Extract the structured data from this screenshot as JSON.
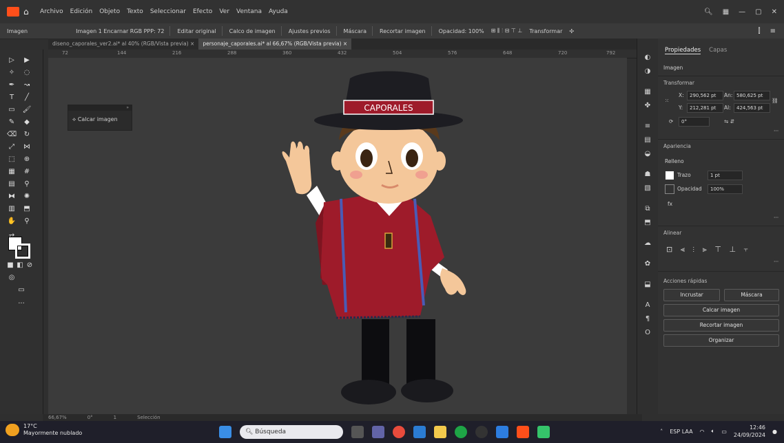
{
  "menubar": {
    "items": [
      "Archivo",
      "Edición",
      "Objeto",
      "Texto",
      "Seleccionar",
      "Efecto",
      "Ver",
      "Ventana",
      "Ayuda"
    ],
    "window_controls": [
      "—",
      "▢",
      "✕"
    ]
  },
  "control_bar": {
    "label": "Imagen",
    "items": [
      "Imagen 1 Encarnar  RGB  PPP: 72",
      "Editar original",
      "Calco de imagen",
      "Ajustes previos",
      "Máscara",
      "Recortar imagen",
      "Opacidad: 100%",
      "Transformar"
    ]
  },
  "document_tabs": [
    {
      "label": "diseno_caporales_ver2.ai* al 40% (RGB/Vista previa)",
      "active": false
    },
    {
      "label": "personaje_caporales.ai* al 66,67% (RGB/Vista previa)",
      "active": true
    }
  ],
  "ruler_ticks": [
    "72",
    "144",
    "216",
    "288",
    "360",
    "432",
    "504",
    "576",
    "648",
    "720",
    "792"
  ],
  "float_panel": {
    "label": "Calcar imagen"
  },
  "artwork": {
    "hat_band_text": "CAPORALES"
  },
  "properties": {
    "tabs": [
      "Propiedades",
      "Capas"
    ],
    "object_type": "Imagen",
    "transform_label": "Transformar",
    "x_label": "X:",
    "x_value": "290,562 pt",
    "y_label": "Y:",
    "y_value": "212,281 pt",
    "w_label": "An:",
    "w_value": "580,625 pt",
    "h_label": "Al:",
    "h_value": "424,563 pt",
    "rotate_value": "0°",
    "appearance_label": "Apariencia",
    "fill_label": "Relleno",
    "stroke_label": "Trazo",
    "opacity_label": "Opacidad",
    "opacity_value": "100%",
    "fx_label": "fx",
    "align_label": "Alinear",
    "quick_actions_label": "Acciones rápidas",
    "btn_embed": "Incrustar",
    "btn_mask": "Máscara",
    "btn_trace": "Calcar imagen",
    "btn_crop": "Recortar imagen",
    "btn_arrange": "Organizar"
  },
  "statusbar": {
    "zoom": "66,67%",
    "rotation": "0°",
    "page": "1",
    "tool": "Selección"
  },
  "taskbar": {
    "weather_temp": "17°C",
    "weather_desc": "Mayormente nublado",
    "search_placeholder": "Búsqueda",
    "lang": "ESP LAA",
    "time": "12:46",
    "date": "24/09/2024"
  },
  "colors": {
    "accent": "#ff4f1a",
    "poncho": "#9e1b2a",
    "hat": "#1d1d22",
    "skin": "#f4c79a"
  }
}
